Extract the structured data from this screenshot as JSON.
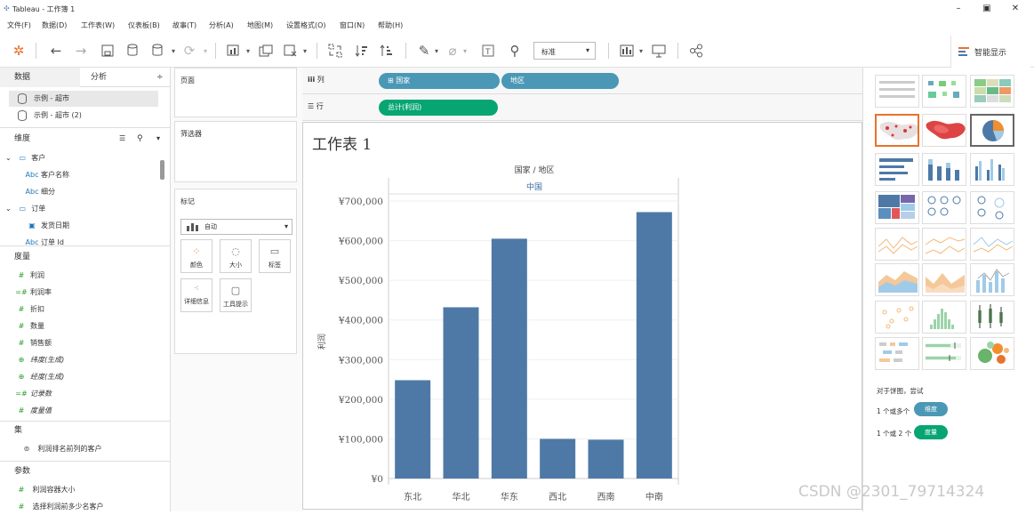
{
  "app": {
    "title": "Tableau - 工作簿 1"
  },
  "window_controls": {
    "minimize": "–",
    "maximize": "▣",
    "close": "✕"
  },
  "menu": [
    "文件(F)",
    "数据(D)",
    "工作表(W)",
    "仪表板(B)",
    "故事(T)",
    "分析(A)",
    "地图(M)",
    "设置格式(O)",
    "窗口(N)",
    "帮助(H)"
  ],
  "toolbar": {
    "fit_select": "标准",
    "show_me": "智能显示"
  },
  "left_panel": {
    "tabs": [
      "数据",
      "分析"
    ],
    "data_sources": [
      "示例 - 超市",
      "示例 - 超市 (2)"
    ],
    "dimensions_header": "维度",
    "dimensions": [
      {
        "icon": "folder",
        "label": "客户",
        "indent": 0
      },
      {
        "icon": "Abc",
        "label": "客户名称",
        "indent": 1
      },
      {
        "icon": "Abc",
        "label": "细分",
        "indent": 1
      },
      {
        "icon": "folder",
        "label": "订单",
        "indent": 0
      },
      {
        "icon": "calendar",
        "label": "发货日期",
        "indent": 1
      },
      {
        "icon": "Abc",
        "label": "订单 Id",
        "indent": 1
      }
    ],
    "measures_header": "度量",
    "measures": [
      {
        "icon": "#",
        "label": "利润",
        "italic": false
      },
      {
        "icon": "=#",
        "label": "利润率",
        "italic": false
      },
      {
        "icon": "#",
        "label": "折扣",
        "italic": false
      },
      {
        "icon": "#",
        "label": "数量",
        "italic": false
      },
      {
        "icon": "#",
        "label": "销售额",
        "italic": false
      },
      {
        "icon": "globe",
        "label": "纬度(生成)",
        "italic": true
      },
      {
        "icon": "globe",
        "label": "经度(生成)",
        "italic": true
      },
      {
        "icon": "=#",
        "label": "记录数",
        "italic": true
      },
      {
        "icon": "#",
        "label": "度量值",
        "italic": true
      }
    ],
    "sets_header": "集",
    "sets": [
      "利润排名前列的客户"
    ],
    "params_header": "参数",
    "params": [
      "利润容器大小",
      "选择利润前多少名客户"
    ]
  },
  "cards": {
    "pages": "页面",
    "filters": "筛选器",
    "marks": "标记",
    "marks_type": "自动",
    "mark_buttons": [
      "颜色",
      "大小",
      "标签",
      "详细信息",
      "工具提示"
    ]
  },
  "shelves": {
    "columns_label": "列",
    "rows_label": "行",
    "columns_pills": [
      "国家",
      "地区"
    ],
    "rows_pills": [
      "总计(利润)"
    ]
  },
  "sheet": {
    "title": "工作表 1",
    "header_top": "国家 / 地区",
    "header_country": "中国",
    "ylabel": "利润"
  },
  "chart_data": {
    "type": "bar",
    "categories": [
      "东北",
      "华北",
      "华东",
      "西北",
      "西南",
      "中南"
    ],
    "values": [
      248000,
      432000,
      605000,
      100000,
      98000,
      672000
    ],
    "ylim": [
      0,
      700000
    ],
    "yticks": [
      "¥0",
      "¥100,000",
      "¥200,000",
      "¥300,000",
      "¥400,000",
      "¥500,000",
      "¥600,000",
      "¥700,000"
    ],
    "ytick_values": [
      0,
      100000,
      200000,
      300000,
      400000,
      500000,
      600000,
      700000
    ],
    "xlabel": "",
    "ylabel": "利润",
    "color": "#4e79a7",
    "grid": true
  },
  "show_me": {
    "hint": "对于饼图，尝试",
    "req1_text": "1 个或多个",
    "req1_pill": "维度",
    "req2_text": "1 个或 2 个",
    "req2_pill": "度量"
  },
  "watermark": "CSDN @2301_79714324",
  "colors": {
    "dimension_pill": "#4a98b5",
    "measure_pill": "#07a572",
    "bar": "#4e79a7"
  }
}
